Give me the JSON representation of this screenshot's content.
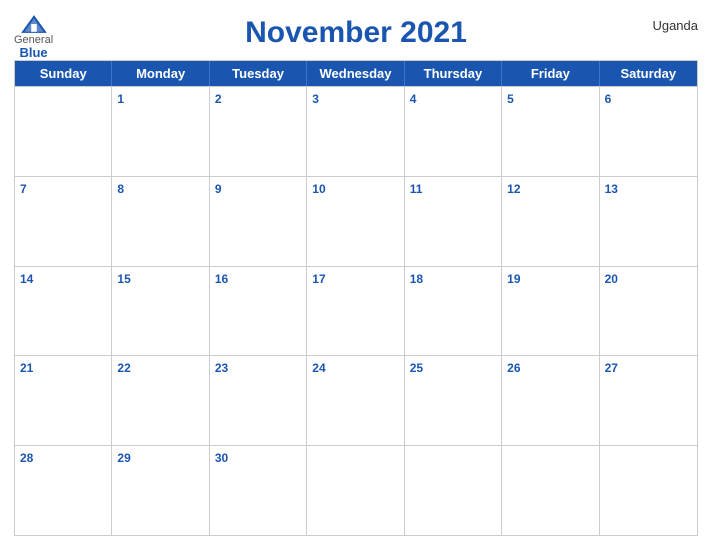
{
  "header": {
    "title": "November 2021",
    "country": "Uganda",
    "logo": {
      "general": "General",
      "blue": "Blue"
    }
  },
  "colors": {
    "primary": "#1a56b0",
    "headerText": "#ffffff",
    "cellBorder": "#cccccc",
    "dayNumber": "#1a56b0"
  },
  "dayHeaders": [
    "Sunday",
    "Monday",
    "Tuesday",
    "Wednesday",
    "Thursday",
    "Friday",
    "Saturday"
  ],
  "weeks": [
    [
      {
        "day": "",
        "empty": true
      },
      {
        "day": "1"
      },
      {
        "day": "2"
      },
      {
        "day": "3"
      },
      {
        "day": "4"
      },
      {
        "day": "5"
      },
      {
        "day": "6"
      }
    ],
    [
      {
        "day": "7"
      },
      {
        "day": "8"
      },
      {
        "day": "9"
      },
      {
        "day": "10"
      },
      {
        "day": "11"
      },
      {
        "day": "12"
      },
      {
        "day": "13"
      }
    ],
    [
      {
        "day": "14"
      },
      {
        "day": "15"
      },
      {
        "day": "16"
      },
      {
        "day": "17"
      },
      {
        "day": "18"
      },
      {
        "day": "19"
      },
      {
        "day": "20"
      }
    ],
    [
      {
        "day": "21"
      },
      {
        "day": "22"
      },
      {
        "day": "23"
      },
      {
        "day": "24"
      },
      {
        "day": "25"
      },
      {
        "day": "26"
      },
      {
        "day": "27"
      }
    ],
    [
      {
        "day": "28"
      },
      {
        "day": "29"
      },
      {
        "day": "30"
      },
      {
        "day": "",
        "empty": true
      },
      {
        "day": "",
        "empty": true
      },
      {
        "day": "",
        "empty": true
      },
      {
        "day": "",
        "empty": true
      }
    ]
  ]
}
